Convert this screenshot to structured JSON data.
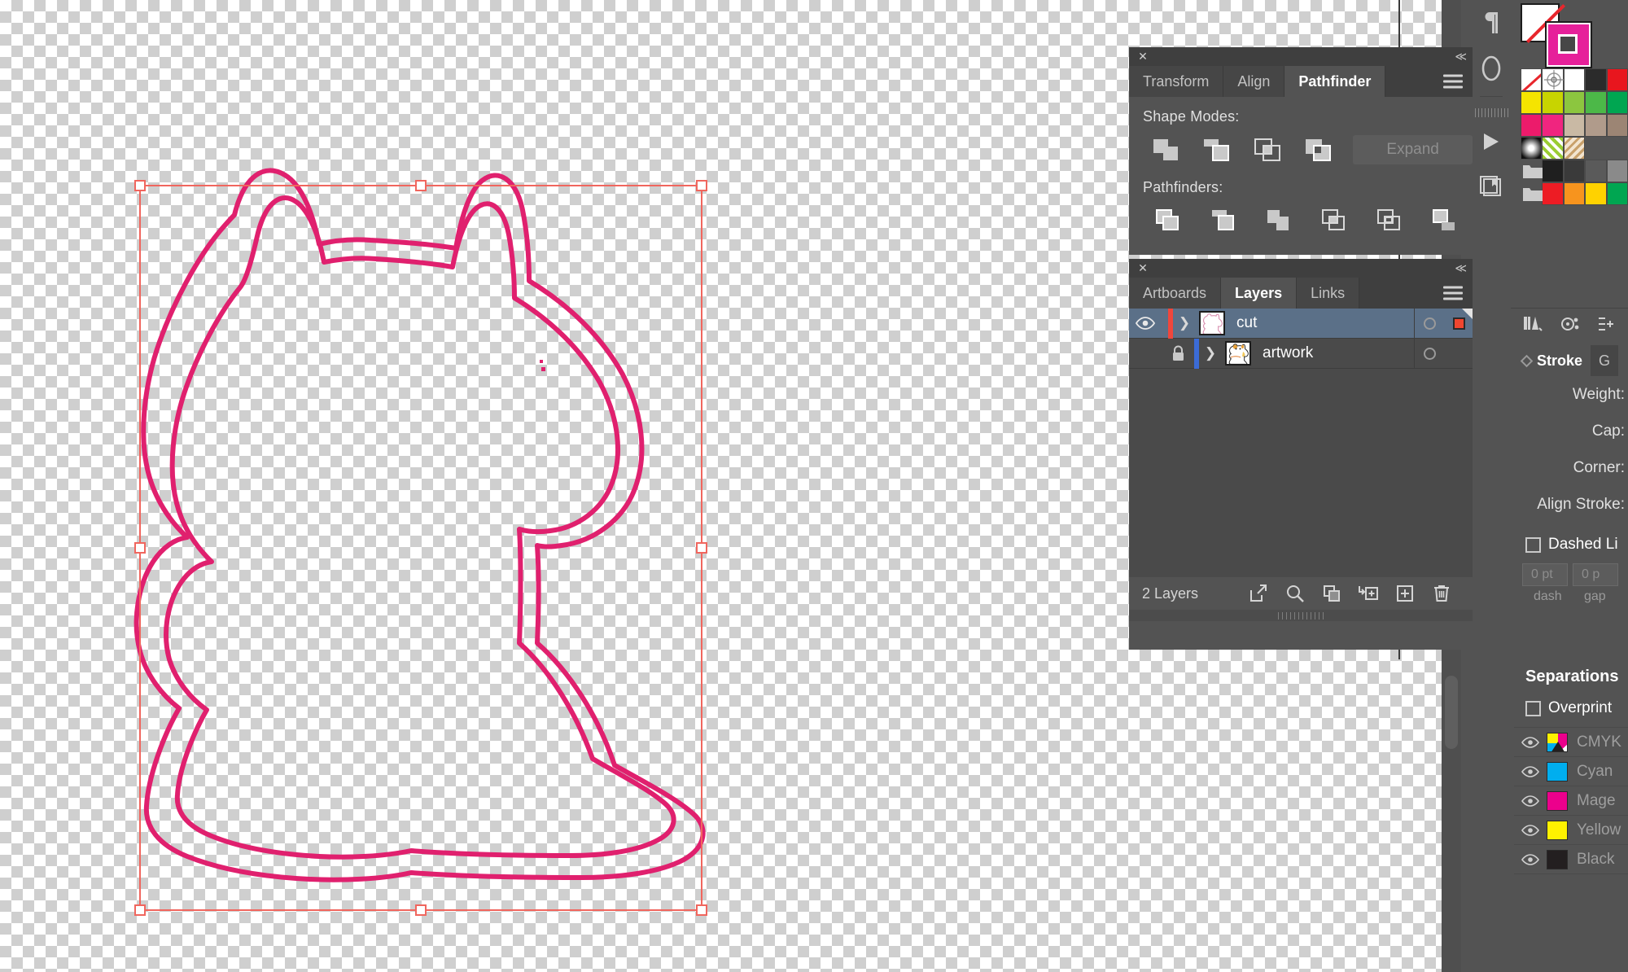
{
  "app": "Adobe Illustrator",
  "canvas": {
    "artwork_name": "cut-outline-lucky-cat",
    "stroke_color": "#E0206E",
    "selection_color": "#F0665E",
    "selection_handle_fill": "#FFFFFF",
    "checker_light": "#FFFFFF",
    "checker_dark": "#CFCFCF"
  },
  "pathfinder": {
    "tabs": [
      {
        "label": "Transform",
        "active": false
      },
      {
        "label": "Align",
        "active": false
      },
      {
        "label": "Pathfinder",
        "active": true
      }
    ],
    "shape_modes_label": "Shape Modes:",
    "shape_modes": [
      {
        "name": "unite",
        "title": "Unite"
      },
      {
        "name": "minus-front",
        "title": "Minus Front"
      },
      {
        "name": "intersect",
        "title": "Intersect"
      },
      {
        "name": "exclude",
        "title": "Exclude"
      }
    ],
    "expand_label": "Expand",
    "expand_enabled": false,
    "pathfinders_label": "Pathfinders:",
    "pathfinders": [
      {
        "name": "divide",
        "title": "Divide"
      },
      {
        "name": "trim",
        "title": "Trim"
      },
      {
        "name": "merge",
        "title": "Merge"
      },
      {
        "name": "crop",
        "title": "Crop"
      },
      {
        "name": "outline",
        "title": "Outline"
      },
      {
        "name": "minus-back",
        "title": "Minus Back"
      }
    ]
  },
  "layers": {
    "tabs": [
      {
        "label": "Artboards",
        "active": false
      },
      {
        "label": "Layers",
        "active": true
      },
      {
        "label": "Links",
        "active": false
      }
    ],
    "rows": [
      {
        "name": "cut",
        "visible": true,
        "locked": false,
        "selected": true,
        "color": "#F0463C",
        "has_target_ring": true,
        "has_selection_square": true,
        "thumb": "cut-outline-thumb"
      },
      {
        "name": "artwork",
        "visible": false,
        "locked": true,
        "selected": false,
        "color": "#3B6BD6",
        "has_target_ring": true,
        "has_selection_square": false,
        "thumb": "artwork-cat-thumb"
      }
    ],
    "footer": {
      "count_label": "2 Layers",
      "buttons": [
        {
          "name": "release-to-layers-icon",
          "title": "Release to Layers"
        },
        {
          "name": "locate-object-icon",
          "title": "Locate Object"
        },
        {
          "name": "make-clipping-mask-icon",
          "title": "Make/Release Clipping Mask"
        },
        {
          "name": "new-sublayer-icon",
          "title": "Create New Sublayer"
        },
        {
          "name": "new-layer-icon",
          "title": "Create New Layer"
        },
        {
          "name": "delete-layer-icon",
          "title": "Delete Selection"
        }
      ]
    }
  },
  "icon_dock": [
    {
      "name": "paragraph-icon",
      "glyph": "¶"
    },
    {
      "name": "glyphs-icon",
      "glyph": "O"
    },
    {
      "name": "actions-play-icon",
      "glyph": "▶"
    },
    {
      "name": "libraries-icon",
      "glyph": "book"
    }
  ],
  "color_controls": {
    "fill_label": "None",
    "fill_color": "#FFFFFF",
    "fill_none_slash": "#E8262C",
    "stroke_color": "#E6209A"
  },
  "swatches": [
    [
      "none",
      "#FFFFFF",
      "#FFFFFF",
      "#2B2B2B",
      "#E8161E"
    ],
    [
      "#F5E400",
      "#C8D400",
      "#8CC63F",
      "#4CB848",
      "#00A651"
    ],
    [
      "#EC1B6B",
      "#F0257F",
      "#C9B9A4",
      "#B09B8B",
      "#9C8574"
    ],
    [
      "#1A1A1A",
      "#9ACD32",
      "#C8A06A",
      "#535353",
      "#535353"
    ],
    [
      "folder",
      "#1F1F1F",
      "#3A3A3A",
      "#5A5A5A",
      "#8A8A8A"
    ],
    [
      "folder",
      "#ED1C24",
      "#F7941E",
      "#FFD200",
      "#00A651"
    ]
  ],
  "stroke_panel": {
    "tabs": [
      {
        "label": "Stroke",
        "active": true
      },
      {
        "label": "G",
        "active": false
      }
    ],
    "fields": [
      {
        "label": "Weight:"
      },
      {
        "label": "Cap:"
      },
      {
        "label": "Corner:"
      },
      {
        "label": "Align Stroke:"
      }
    ],
    "dashed_line_label": "Dashed Li",
    "dashed_line_checked": false,
    "dash_value": "0 pt",
    "gap_value": "0 p",
    "dash_label": "dash",
    "gap_label": "gap"
  },
  "separations": {
    "title": "Separations",
    "overprint_label": "Overprint",
    "overprint_checked": false,
    "rows": [
      {
        "name": "CMYK",
        "color": "cmyk",
        "visible": true
      },
      {
        "name": "Cyan",
        "color": "#00AEEF",
        "visible": true
      },
      {
        "name": "Mage",
        "color": "#EC008C",
        "visible": true
      },
      {
        "name": "Yellow",
        "color": "#FFF200",
        "visible": true
      },
      {
        "name": "Black",
        "color": "#231F20",
        "visible": true
      }
    ]
  }
}
